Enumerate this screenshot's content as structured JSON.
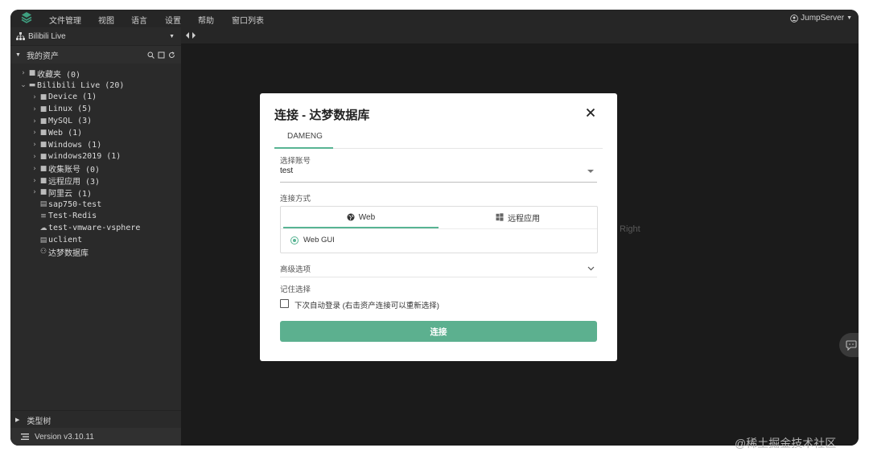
{
  "menubar": {
    "items": [
      "文件管理",
      "视图",
      "语言",
      "设置",
      "帮助",
      "窗口列表"
    ],
    "user": "JumpServer"
  },
  "sidebar": {
    "project": "Bilibili Live",
    "assets_title": "我的资产",
    "tree": [
      {
        "label": "收藏夹 (0)",
        "level": 0,
        "expander": "collapsed",
        "icon": "folder-icon"
      },
      {
        "label": "Bilibili Live (20)",
        "level": 0,
        "expander": "expanded",
        "icon": "folder-open-icon"
      },
      {
        "label": "Device (1)",
        "level": 1,
        "expander": "collapsed",
        "icon": "folder-icon"
      },
      {
        "label": "Linux (5)",
        "level": 1,
        "expander": "collapsed",
        "icon": "folder-icon"
      },
      {
        "label": "MySQL (3)",
        "level": 1,
        "expander": "collapsed",
        "icon": "folder-icon"
      },
      {
        "label": "Web (1)",
        "level": 1,
        "expander": "collapsed",
        "icon": "folder-icon"
      },
      {
        "label": "Windows (1)",
        "level": 1,
        "expander": "collapsed",
        "icon": "folder-icon"
      },
      {
        "label": "windows2019 (1)",
        "level": 1,
        "expander": "collapsed",
        "icon": "folder-icon"
      },
      {
        "label": "收集账号 (0)",
        "level": 1,
        "expander": "collapsed",
        "icon": "folder-icon"
      },
      {
        "label": "远程应用 (3)",
        "level": 1,
        "expander": "collapsed",
        "icon": "folder-icon"
      },
      {
        "label": "阿里云 (1)",
        "level": 1,
        "expander": "collapsed",
        "icon": "folder-icon"
      },
      {
        "label": "sap750-test",
        "level": 1,
        "expander": "none",
        "icon": "server-icon"
      },
      {
        "label": "Test-Redis",
        "level": 1,
        "expander": "none",
        "icon": "database-icon"
      },
      {
        "label": "test-vmware-vsphere",
        "level": 1,
        "expander": "none",
        "icon": "cloud-icon"
      },
      {
        "label": "uclient",
        "level": 1,
        "expander": "none",
        "icon": "server-icon"
      },
      {
        "label": "达梦数据库",
        "level": 1,
        "expander": "none",
        "icon": "database-plug-icon"
      }
    ],
    "type_tree": "类型树",
    "version": "Version v3.10.11"
  },
  "main": {
    "right_label": "Right"
  },
  "modal": {
    "title": "连接 - 达梦数据库",
    "tab": "DAMENG",
    "account_label": "选择账号",
    "account_value": "test",
    "method_label": "连接方式",
    "method_tabs": [
      "Web",
      "远程应用"
    ],
    "selected_method_tab": "Web",
    "option": "Web GUI",
    "advanced": "高级选项",
    "remember_label": "记住选择",
    "auto_login": "下次自动登录 (右击资产连接可以重新选择)",
    "auto_login_checked": false,
    "connect": "连接"
  },
  "watermark": "@稀土掘金技术社区",
  "colors": {
    "accent": "#5cb08f",
    "sidebar_bg": "#2a2a2a",
    "main_bg": "#1b1b1b"
  }
}
